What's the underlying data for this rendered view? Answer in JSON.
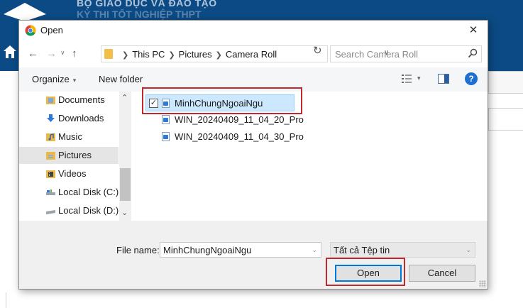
{
  "background": {
    "banner_text_line1": "BỘ GIÁO DỤC VÀ ĐÀO TẠO",
    "banner_text_line2": "KỲ THI TỐT NGHIỆP THPT",
    "accent_color": "#0b4a84"
  },
  "dialog": {
    "title": "Open",
    "app_icon": "chrome-icon",
    "close_label": "✕"
  },
  "address": {
    "crumbs": [
      "This PC",
      "Pictures",
      "Camera Roll"
    ],
    "search_placeholder": "Search Camera Roll"
  },
  "toolbar": {
    "organize_label": "Organize",
    "new_folder_label": "New folder",
    "help_label": "?"
  },
  "nav": {
    "items": [
      {
        "label": "Documents",
        "icon": "documents-folder-icon",
        "selected": false
      },
      {
        "label": "Downloads",
        "icon": "downloads-folder-icon",
        "selected": false
      },
      {
        "label": "Music",
        "icon": "music-folder-icon",
        "selected": false
      },
      {
        "label": "Pictures",
        "icon": "pictures-folder-icon",
        "selected": true
      },
      {
        "label": "Videos",
        "icon": "videos-folder-icon",
        "selected": false
      },
      {
        "label": "Local Disk (C:)",
        "icon": "disk-icon",
        "selected": false
      },
      {
        "label": "Local Disk (D:)",
        "icon": "disk-icon",
        "selected": false
      }
    ]
  },
  "files": [
    {
      "name": "MinhChungNgoaiNgu",
      "selected": true,
      "checked": true
    },
    {
      "name": "WIN_20240409_11_04_20_Pro",
      "selected": false,
      "checked": false
    },
    {
      "name": "WIN_20240409_11_04_30_Pro",
      "selected": false,
      "checked": false
    }
  ],
  "footer": {
    "file_name_label": "File name:",
    "file_name_value": "MinhChungNgoaiNgu",
    "file_type_value": "Tất cả Tệp tin",
    "open_label": "Open",
    "cancel_label": "Cancel"
  },
  "highlight_color": "#c0292f"
}
